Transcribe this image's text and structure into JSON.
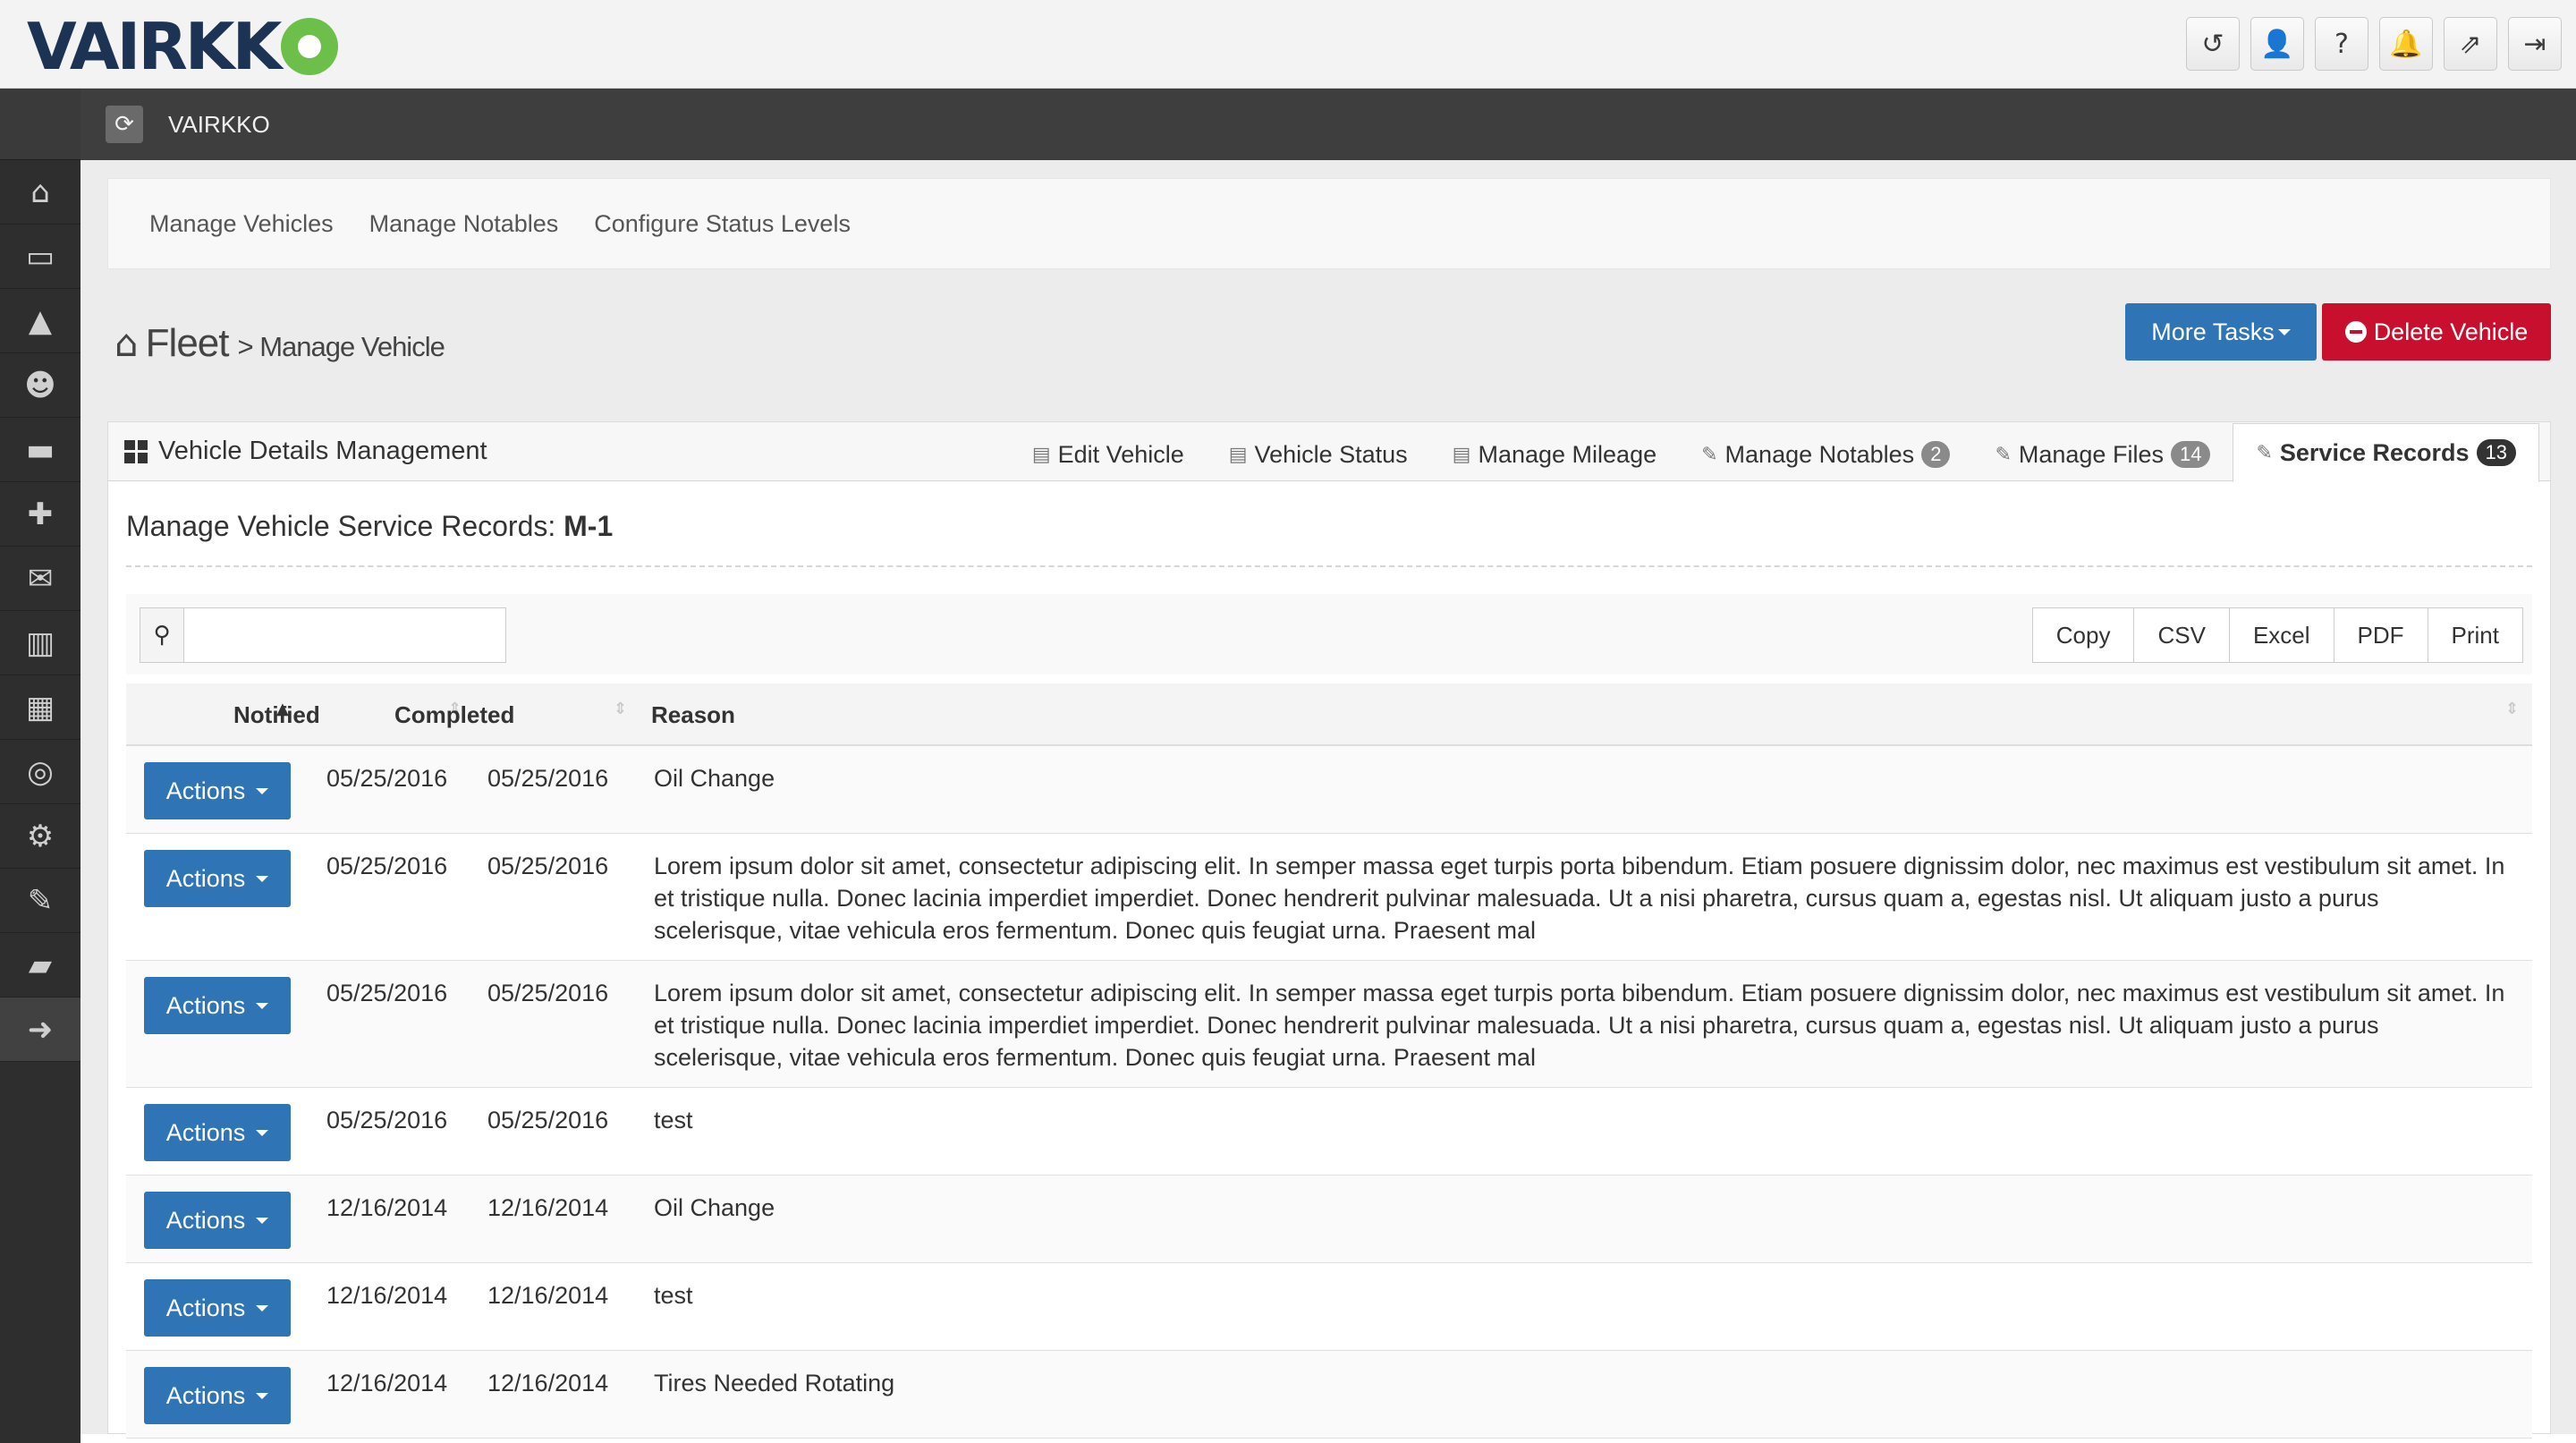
{
  "brand": {
    "logo_text": "VAIRKK"
  },
  "top_icons": [
    {
      "icon": "history-icon",
      "glyph": "↺"
    },
    {
      "icon": "user-icon",
      "glyph": "👤"
    },
    {
      "icon": "help-icon",
      "glyph": "?"
    },
    {
      "icon": "bell-icon",
      "glyph": "🔔"
    },
    {
      "icon": "external-link-icon",
      "glyph": "⇗"
    },
    {
      "icon": "sign-out-icon",
      "glyph": "⇥"
    }
  ],
  "sidebar": {
    "items": [
      {
        "icon": "home-icon",
        "glyph": "⌂"
      },
      {
        "icon": "inbox-icon",
        "glyph": "▭"
      },
      {
        "icon": "graduation-cap-icon",
        "glyph": "▲"
      },
      {
        "icon": "users-icon",
        "glyph": "☻"
      },
      {
        "icon": "hdd-icon",
        "glyph": "▬"
      },
      {
        "icon": "medkit-icon",
        "glyph": "✚"
      },
      {
        "icon": "envelope-icon",
        "glyph": "✉"
      },
      {
        "icon": "bar-chart-icon",
        "glyph": "▥"
      },
      {
        "icon": "calendar-icon",
        "glyph": "▦"
      },
      {
        "icon": "life-ring-icon",
        "glyph": "◎"
      },
      {
        "icon": "cogs-icon",
        "glyph": "⚙"
      },
      {
        "icon": "wrench-icon",
        "glyph": "✎"
      },
      {
        "icon": "truck-icon",
        "glyph": "▰"
      },
      {
        "icon": "arrow-circle-right-icon",
        "glyph": "➜"
      }
    ]
  },
  "darkbar": {
    "label": "VAIRKKO",
    "refresh_glyph": "⟳"
  },
  "subnav": {
    "items": [
      "Manage Vehicles",
      "Manage Notables",
      "Configure Status Levels"
    ]
  },
  "page": {
    "home_glyph": "⌂",
    "heading": "Fleet",
    "subheading": "> Manage Vehicle"
  },
  "buttons": {
    "more_tasks": "More Tasks",
    "delete_vehicle": "Delete Vehicle"
  },
  "panel": {
    "title": "Vehicle Details Management",
    "tabs": [
      {
        "label": "Edit Vehicle",
        "icon": "keyboard-icon",
        "glyph": "▤",
        "badge": ""
      },
      {
        "label": "Vehicle Status",
        "icon": "keyboard-icon",
        "glyph": "▤",
        "badge": ""
      },
      {
        "label": "Manage Mileage",
        "icon": "keyboard-icon",
        "glyph": "▤",
        "badge": ""
      },
      {
        "label": "Manage Notables",
        "icon": "edit-icon",
        "glyph": "✎",
        "badge": "2"
      },
      {
        "label": "Manage Files",
        "icon": "edit-icon",
        "glyph": "✎",
        "badge": "14"
      },
      {
        "label": "Service Records",
        "icon": "edit-icon",
        "glyph": "✎",
        "badge": "13",
        "active": true
      }
    ]
  },
  "records": {
    "title_prefix": "Manage Vehicle Service Records: ",
    "vehicle_id": "M-1",
    "search_placeholder": "",
    "search_glyph": "⚲",
    "export_buttons": [
      "Copy",
      "CSV",
      "Excel",
      "PDF",
      "Print"
    ],
    "columns": {
      "notified": "Notified",
      "completed": "Completed",
      "reason": "Reason"
    },
    "action_label": "Actions",
    "rows": [
      {
        "notified": "05/25/2016",
        "completed": "05/25/2016",
        "reason": "Oil Change"
      },
      {
        "notified": "05/25/2016",
        "completed": "05/25/2016",
        "reason": "Lorem ipsum dolor sit amet, consectetur adipiscing elit. In semper massa eget turpis porta bibendum. Etiam posuere dignissim dolor, nec maximus est vestibulum sit amet. In et tristique nulla. Donec lacinia imperdiet imperdiet. Donec hendrerit pulvinar malesuada. Ut a nisi pharetra, cursus quam a, egestas nisl. Ut aliquam justo a purus scelerisque, vitae vehicula eros fermentum. Donec quis feugiat urna. Praesent mal"
      },
      {
        "notified": "05/25/2016",
        "completed": "05/25/2016",
        "reason": "Lorem ipsum dolor sit amet, consectetur adipiscing elit. In semper massa eget turpis porta bibendum. Etiam posuere dignissim dolor, nec maximus est vestibulum sit amet. In et tristique nulla. Donec lacinia imperdiet imperdiet. Donec hendrerit pulvinar malesuada. Ut a nisi pharetra, cursus quam a, egestas nisl. Ut aliquam justo a purus scelerisque, vitae vehicula eros fermentum. Donec quis feugiat urna. Praesent mal"
      },
      {
        "notified": "05/25/2016",
        "completed": "05/25/2016",
        "reason": "test"
      },
      {
        "notified": "12/16/2014",
        "completed": "12/16/2014",
        "reason": "Oil Change"
      },
      {
        "notified": "12/16/2014",
        "completed": "12/16/2014",
        "reason": "test"
      },
      {
        "notified": "12/16/2014",
        "completed": "12/16/2014",
        "reason": "Tires Needed Rotating"
      }
    ]
  },
  "colors": {
    "primary": "#2f75b5",
    "danger": "#c8102e",
    "logo_navy": "#1d3354",
    "logo_green": "#6cc04a"
  }
}
